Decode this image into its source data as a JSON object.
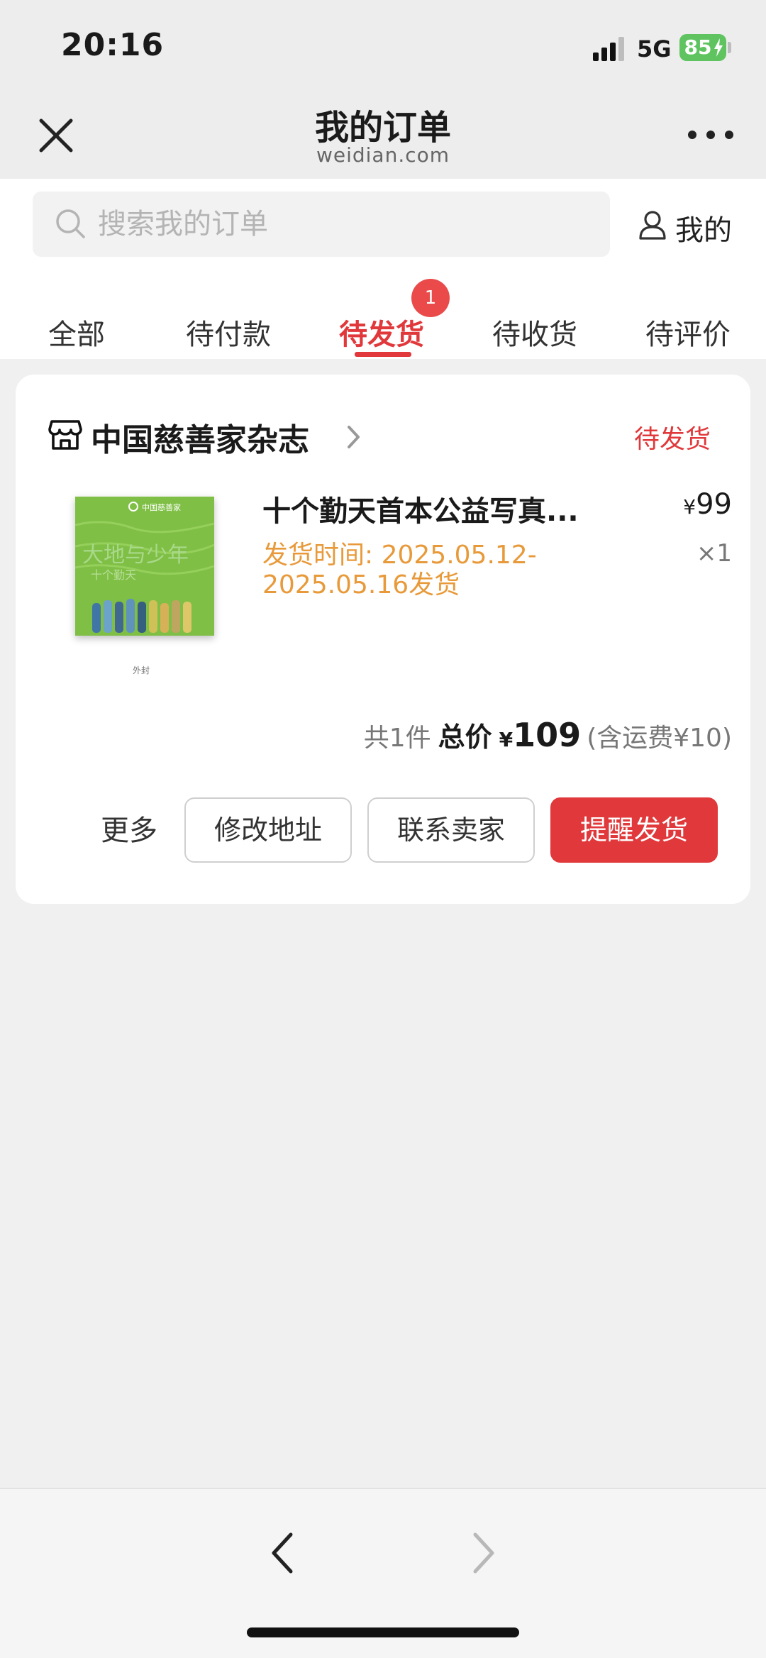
{
  "status_bar": {
    "time": "20:16",
    "network": "5G",
    "battery": "85"
  },
  "nav": {
    "title": "我的订单",
    "subtitle": "weidian.com",
    "close_icon": "close-icon",
    "more_icon": "more-dots-icon"
  },
  "search": {
    "placeholder": "搜索我的订单",
    "icon": "search-icon"
  },
  "mine": {
    "label": "我的",
    "icon": "user-icon"
  },
  "tabs": [
    {
      "label": "全部"
    },
    {
      "label": "待付款"
    },
    {
      "label": "待发货",
      "active": true,
      "badge": "1"
    },
    {
      "label": "待收货"
    },
    {
      "label": "待评价"
    }
  ],
  "order": {
    "shop_name": "中国慈善家杂志",
    "status": "待发货",
    "product": {
      "title": "十个勤天首本公益写真...",
      "ship_time": "发货时间: 2025.05.12-2025.05.16发货",
      "price_symbol": "¥",
      "price": "99",
      "qty": "×1",
      "image_caption": "外封",
      "cover_brand": "中国慈善家",
      "cover_title": "大地与少年",
      "cover_subtitle": "十个勤天"
    },
    "total": {
      "count": "共1件",
      "label": "总价",
      "symbol": "¥",
      "amount": "109",
      "shipping": "(含运费¥10)"
    },
    "actions": {
      "more": "更多",
      "change_address": "修改地址",
      "contact_seller": "联系卖家",
      "remind_ship": "提醒发货"
    }
  },
  "colors": {
    "accent": "#e0383b",
    "ship_time": "#e89a3a",
    "battery": "#5fc45f",
    "cover": "#7fbf45"
  }
}
